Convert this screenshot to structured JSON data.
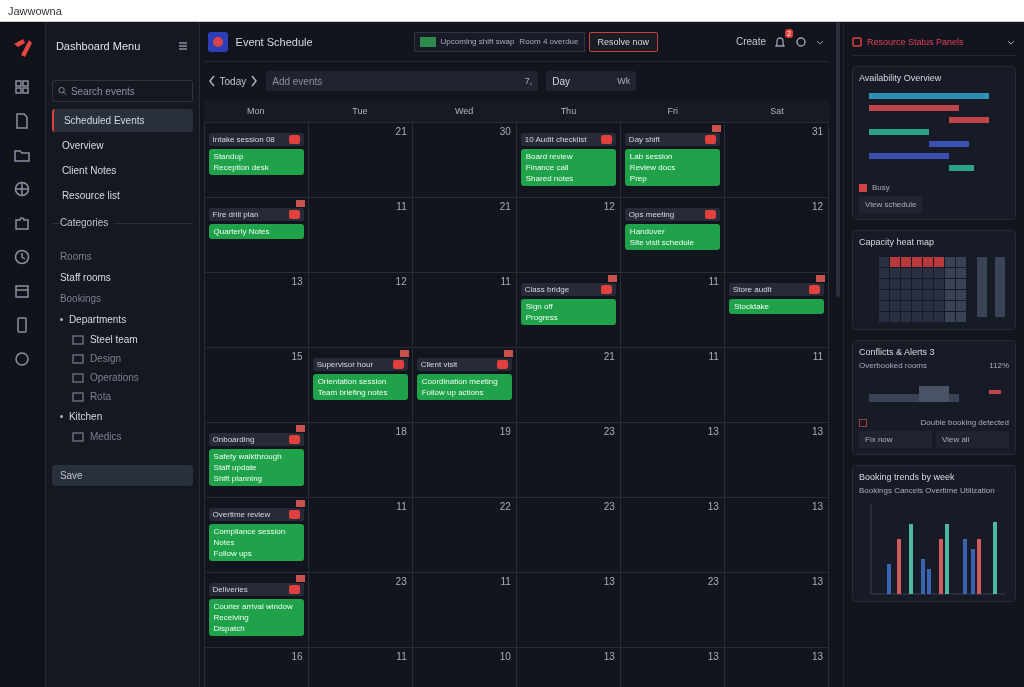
{
  "window": {
    "title": "Jawwowna"
  },
  "sidebar": {
    "title": "Dashboard Menu",
    "search": {
      "placeholder": "Search events"
    },
    "items": [
      {
        "label": "Scheduled Events",
        "selected": true
      },
      {
        "label": "Overview",
        "selected": false
      },
      {
        "label": "Client Notes",
        "selected": false
      },
      {
        "label": "Resource list",
        "selected": false
      }
    ],
    "section": "Categories",
    "tree": [
      {
        "label": "Rooms",
        "dim": true
      },
      {
        "label": "Staff rooms",
        "dim": false
      },
      {
        "label": "Bookings",
        "dim": true
      },
      {
        "label": "Departments",
        "dim": false,
        "children": [
          {
            "label": "Steel team",
            "dim": false
          },
          {
            "label": "Design",
            "dim": true
          },
          {
            "label": "Operations",
            "dim": true
          },
          {
            "label": "Rota",
            "dim": true
          }
        ]
      },
      {
        "label": "Kitchen",
        "dim": false,
        "children": [
          {
            "label": "Medics",
            "dim": true
          }
        ]
      }
    ],
    "footer_button": "Save"
  },
  "header": {
    "title": "Event Schedule",
    "notice": {
      "text": "Upcoming shift swap",
      "detail": "Room 4 overdue"
    },
    "alert_button": "Resolve now",
    "create": "Create",
    "bell_count": "2"
  },
  "toolbar": {
    "nav": "Today",
    "search": {
      "placeholder": "Add events",
      "hint": "7,"
    },
    "filter": {
      "value": "Day",
      "hint": "Wk"
    }
  },
  "calendar": {
    "weekdays": [
      "Mon",
      "Tue",
      "Wed",
      "Thu",
      "Fri",
      "Sat"
    ],
    "weeks": [
      [
        {
          "event": {
            "title": "Intake session 08",
            "flagged": false,
            "lines": [
              "Standup",
              "Reception desk"
            ]
          }
        },
        {
          "number": "21"
        },
        {
          "number": "30"
        },
        {
          "event": {
            "title": "10 Audit checklist",
            "flagged": false,
            "lines": [
              "Board review",
              "Finance call",
              "Shared notes"
            ]
          }
        },
        {
          "event": {
            "title": "Day shift",
            "flagged": true,
            "lines": [
              "Lab session",
              "Review docs",
              "Prep"
            ]
          }
        },
        {
          "number": "31"
        }
      ],
      [
        {
          "event": {
            "title": "Fire drill plan",
            "flagged": true,
            "lines": [
              "Quarterly  Notes"
            ]
          }
        },
        {
          "number": "11"
        },
        {
          "number": "21"
        },
        {
          "number": "12"
        },
        {
          "event": {
            "title": "Ops meeting",
            "flagged": false,
            "lines": [
              "Handover",
              "Site visit schedule"
            ]
          }
        },
        {
          "number": "12"
        }
      ],
      [
        {
          "number": "13"
        },
        {
          "number": "12"
        },
        {
          "number": "11"
        },
        {
          "event": {
            "title": "Class bridge",
            "flagged": true,
            "lines": [
              "Sign off",
              "Progress"
            ]
          }
        },
        {
          "number": "11"
        },
        {
          "event": {
            "title": "Store audit",
            "flagged": true,
            "lines": [
              "Stocktake"
            ]
          }
        }
      ],
      [
        {
          "number": "15"
        },
        {
          "event": {
            "title": "Supervisor hour",
            "flagged": true,
            "lines": [
              "Orientation session",
              "Team briefing notes"
            ]
          }
        },
        {
          "event": {
            "title": "Client visit",
            "flagged": true,
            "lines": [
              "Coordination meeting",
              "Follow up actions"
            ]
          }
        },
        {
          "number": "21"
        },
        {
          "number": "11"
        },
        {
          "number": "11"
        }
      ],
      [
        {
          "event": {
            "title": "Onboarding",
            "flagged": true,
            "lines": [
              "Safety walkthrough",
              "Staff update",
              "Shift planning"
            ]
          }
        },
        {
          "number": "18"
        },
        {
          "number": "19"
        },
        {
          "number": "23"
        },
        {
          "number": "13"
        },
        {
          "number": "13"
        }
      ],
      [
        {
          "event": {
            "title": "Overtime review",
            "flagged": true,
            "lines": [
              "Compliance session",
              "Notes",
              "Follow ups"
            ]
          }
        },
        {
          "number": "11"
        },
        {
          "number": "22"
        },
        {
          "number": "23"
        },
        {
          "number": "13"
        },
        {
          "number": "13"
        }
      ],
      [
        {
          "event": {
            "title": "Deliveries",
            "flagged": true,
            "lines": [
              "Courier arrival window",
              "Receiving",
              "Dispatch"
            ]
          }
        },
        {
          "number": "23"
        },
        {
          "number": "11"
        },
        {
          "number": "13"
        },
        {
          "number": "23"
        },
        {
          "number": "13"
        }
      ],
      [
        {
          "number": "16"
        },
        {
          "number": "11"
        },
        {
          "number": "10"
        },
        {
          "number": "13"
        },
        {
          "number": "13"
        },
        {
          "number": "13"
        }
      ]
    ]
  },
  "panel": {
    "title": "Resource Status Panels",
    "availability": {
      "title": "Availability Overview",
      "legend": "Busy",
      "button": "View schedule"
    },
    "heatmap": {
      "title": "Capacity heat map"
    },
    "conflicts": {
      "title": "Conflicts & Alerts 3",
      "label": "Overbooked rooms",
      "reading": "112%",
      "note": "Double booking detected",
      "buttons": [
        "Fix now",
        "View all"
      ]
    },
    "trends": {
      "title": "Booking trends by week",
      "legend": "Bookings Cancels Overtime Utilization"
    }
  }
}
